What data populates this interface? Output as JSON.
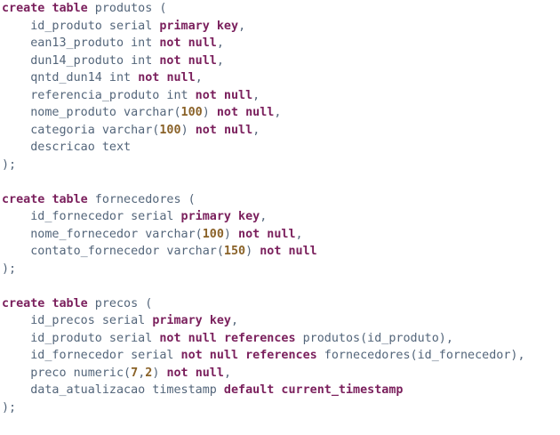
{
  "editor": {
    "colors": {
      "background": "#ffffff",
      "text": "#53657a",
      "keyword": "#7a1f5c",
      "number": "#8a6228"
    },
    "lines": [
      [
        {
          "t": "kw",
          "v": "create"
        },
        {
          "t": "ws",
          "v": " "
        },
        {
          "t": "kw",
          "v": "table"
        },
        {
          "t": "txt",
          "v": " produtos ("
        }
      ],
      [
        {
          "t": "txt",
          "v": "    id_produto serial "
        },
        {
          "t": "kw",
          "v": "primary"
        },
        {
          "t": "txt",
          "v": " "
        },
        {
          "t": "kw",
          "v": "key"
        },
        {
          "t": "txt",
          "v": ","
        }
      ],
      [
        {
          "t": "txt",
          "v": "    ean13_produto int "
        },
        {
          "t": "kw",
          "v": "not"
        },
        {
          "t": "txt",
          "v": " "
        },
        {
          "t": "kw",
          "v": "null"
        },
        {
          "t": "txt",
          "v": ","
        }
      ],
      [
        {
          "t": "txt",
          "v": "    dun14_produto int "
        },
        {
          "t": "kw",
          "v": "not"
        },
        {
          "t": "txt",
          "v": " "
        },
        {
          "t": "kw",
          "v": "null"
        },
        {
          "t": "txt",
          "v": ","
        }
      ],
      [
        {
          "t": "txt",
          "v": "    qntd_dun14 int "
        },
        {
          "t": "kw",
          "v": "not"
        },
        {
          "t": "txt",
          "v": " "
        },
        {
          "t": "kw",
          "v": "null"
        },
        {
          "t": "txt",
          "v": ","
        }
      ],
      [
        {
          "t": "txt",
          "v": "    referencia_produto int "
        },
        {
          "t": "kw",
          "v": "not"
        },
        {
          "t": "txt",
          "v": " "
        },
        {
          "t": "kw",
          "v": "null"
        },
        {
          "t": "txt",
          "v": ","
        }
      ],
      [
        {
          "t": "txt",
          "v": "    nome_produto varchar("
        },
        {
          "t": "num",
          "v": "100"
        },
        {
          "t": "txt",
          "v": ") "
        },
        {
          "t": "kw",
          "v": "not"
        },
        {
          "t": "txt",
          "v": " "
        },
        {
          "t": "kw",
          "v": "null"
        },
        {
          "t": "txt",
          "v": ","
        }
      ],
      [
        {
          "t": "txt",
          "v": "    categoria varchar("
        },
        {
          "t": "num",
          "v": "100"
        },
        {
          "t": "txt",
          "v": ") "
        },
        {
          "t": "kw",
          "v": "not"
        },
        {
          "t": "txt",
          "v": " "
        },
        {
          "t": "kw",
          "v": "null"
        },
        {
          "t": "txt",
          "v": ","
        }
      ],
      [
        {
          "t": "txt",
          "v": "    descricao text"
        }
      ],
      [
        {
          "t": "txt",
          "v": ");"
        }
      ],
      [],
      [
        {
          "t": "kw",
          "v": "create"
        },
        {
          "t": "ws",
          "v": " "
        },
        {
          "t": "kw",
          "v": "table"
        },
        {
          "t": "txt",
          "v": " fornecedores ("
        }
      ],
      [
        {
          "t": "txt",
          "v": "    id_fornecedor serial "
        },
        {
          "t": "kw",
          "v": "primary"
        },
        {
          "t": "txt",
          "v": " "
        },
        {
          "t": "kw",
          "v": "key"
        },
        {
          "t": "txt",
          "v": ","
        }
      ],
      [
        {
          "t": "txt",
          "v": "    nome_fornecedor varchar("
        },
        {
          "t": "num",
          "v": "100"
        },
        {
          "t": "txt",
          "v": ") "
        },
        {
          "t": "kw",
          "v": "not"
        },
        {
          "t": "txt",
          "v": " "
        },
        {
          "t": "kw",
          "v": "null"
        },
        {
          "t": "txt",
          "v": ","
        }
      ],
      [
        {
          "t": "txt",
          "v": "    contato_fornecedor varchar("
        },
        {
          "t": "num",
          "v": "150"
        },
        {
          "t": "txt",
          "v": ") "
        },
        {
          "t": "kw",
          "v": "not"
        },
        {
          "t": "txt",
          "v": " "
        },
        {
          "t": "kw",
          "v": "null"
        }
      ],
      [
        {
          "t": "txt",
          "v": ");"
        }
      ],
      [],
      [
        {
          "t": "kw",
          "v": "create"
        },
        {
          "t": "ws",
          "v": " "
        },
        {
          "t": "kw",
          "v": "table"
        },
        {
          "t": "txt",
          "v": " precos ("
        }
      ],
      [
        {
          "t": "txt",
          "v": "    id_precos serial "
        },
        {
          "t": "kw",
          "v": "primary"
        },
        {
          "t": "txt",
          "v": " "
        },
        {
          "t": "kw",
          "v": "key"
        },
        {
          "t": "txt",
          "v": ","
        }
      ],
      [
        {
          "t": "txt",
          "v": "    id_produto serial "
        },
        {
          "t": "kw",
          "v": "not"
        },
        {
          "t": "txt",
          "v": " "
        },
        {
          "t": "kw",
          "v": "null"
        },
        {
          "t": "txt",
          "v": " "
        },
        {
          "t": "kw",
          "v": "references"
        },
        {
          "t": "txt",
          "v": " produtos(id_produto),"
        }
      ],
      [
        {
          "t": "txt",
          "v": "    id_fornecedor serial "
        },
        {
          "t": "kw",
          "v": "not"
        },
        {
          "t": "txt",
          "v": " "
        },
        {
          "t": "kw",
          "v": "null"
        },
        {
          "t": "txt",
          "v": " "
        },
        {
          "t": "kw",
          "v": "references"
        },
        {
          "t": "txt",
          "v": " fornecedores(id_fornecedor),"
        }
      ],
      [
        {
          "t": "txt",
          "v": "    preco numeric("
        },
        {
          "t": "num",
          "v": "7"
        },
        {
          "t": "txt",
          "v": ","
        },
        {
          "t": "num",
          "v": "2"
        },
        {
          "t": "txt",
          "v": ") "
        },
        {
          "t": "kw",
          "v": "not"
        },
        {
          "t": "txt",
          "v": " "
        },
        {
          "t": "kw",
          "v": "null"
        },
        {
          "t": "txt",
          "v": ","
        }
      ],
      [
        {
          "t": "txt",
          "v": "    data_atualizacao timestamp "
        },
        {
          "t": "kw",
          "v": "default"
        },
        {
          "t": "txt",
          "v": " "
        },
        {
          "t": "kw",
          "v": "current_timestamp"
        }
      ],
      [
        {
          "t": "txt",
          "v": ");"
        }
      ]
    ]
  }
}
